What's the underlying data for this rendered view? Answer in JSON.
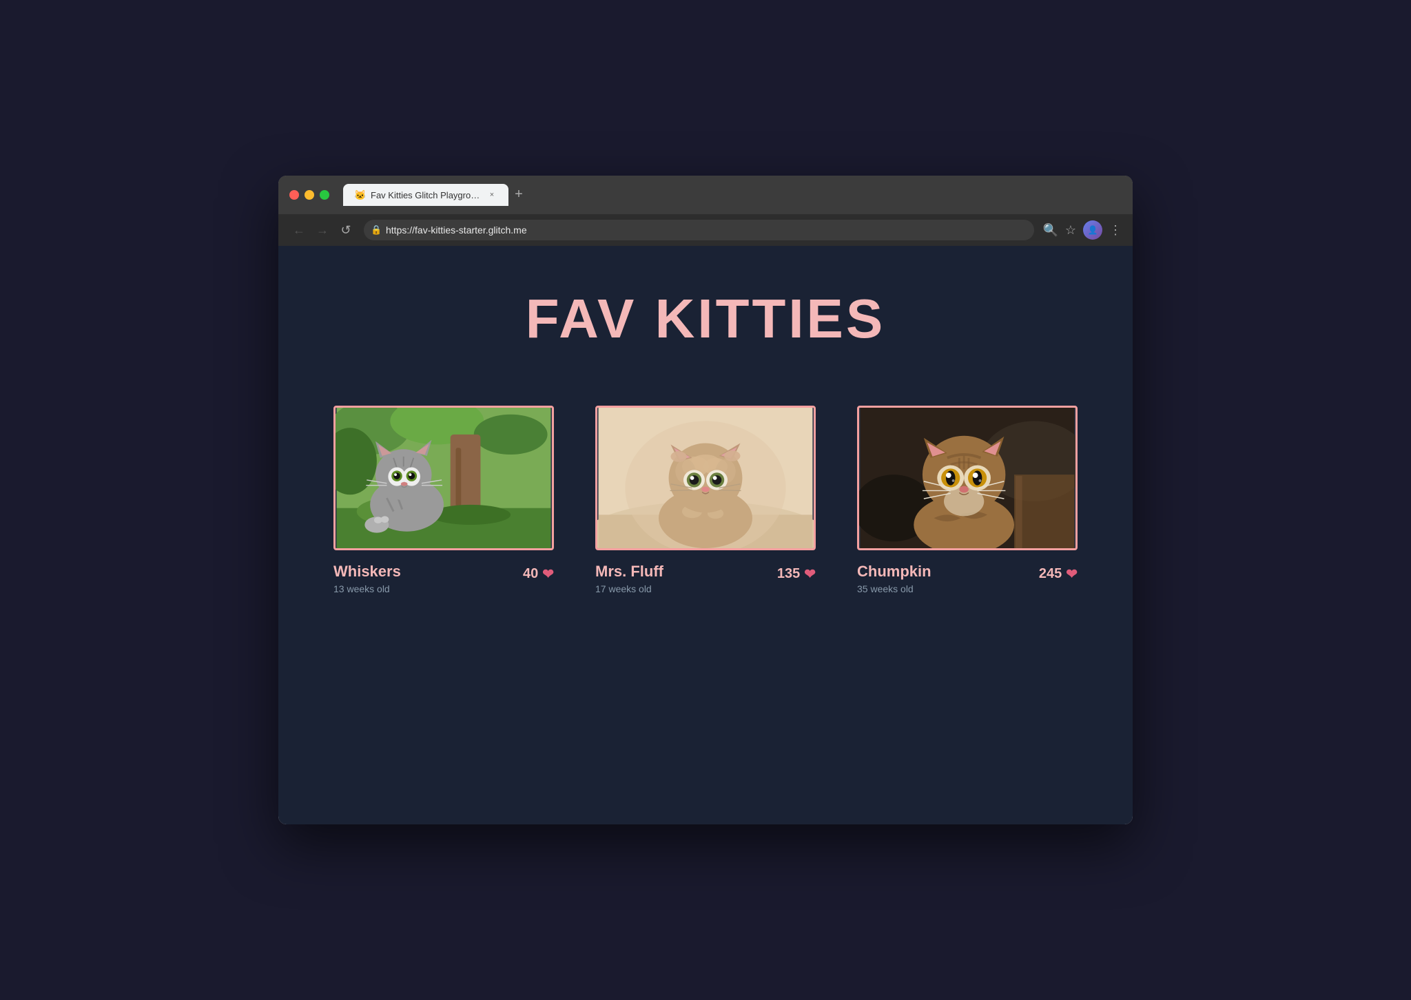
{
  "browser": {
    "tab_title": "Fav Kitties Glitch Playground",
    "tab_favicon": "🐱",
    "tab_close_label": "×",
    "new_tab_label": "+",
    "url": "https://fav-kitties-starter.glitch.me",
    "nav": {
      "back_label": "←",
      "forward_label": "→",
      "reload_label": "↺"
    },
    "toolbar": {
      "search_icon": "🔍",
      "star_icon": "☆",
      "menu_icon": "⋮"
    }
  },
  "page": {
    "title": "FAV KITTIES",
    "kitties": [
      {
        "name": "Whiskers",
        "age": "13 weeks old",
        "likes": 40,
        "cat_type": "whiskers"
      },
      {
        "name": "Mrs. Fluff",
        "age": "17 weeks old",
        "likes": 135,
        "cat_type": "mrfluff"
      },
      {
        "name": "Chumpkin",
        "age": "35 weeks old",
        "likes": 245,
        "cat_type": "chumpkin"
      }
    ]
  },
  "colors": {
    "accent": "#f4b8b8",
    "heart": "#e05c7a",
    "bg": "#1a2234",
    "age_text": "#8899aa"
  }
}
